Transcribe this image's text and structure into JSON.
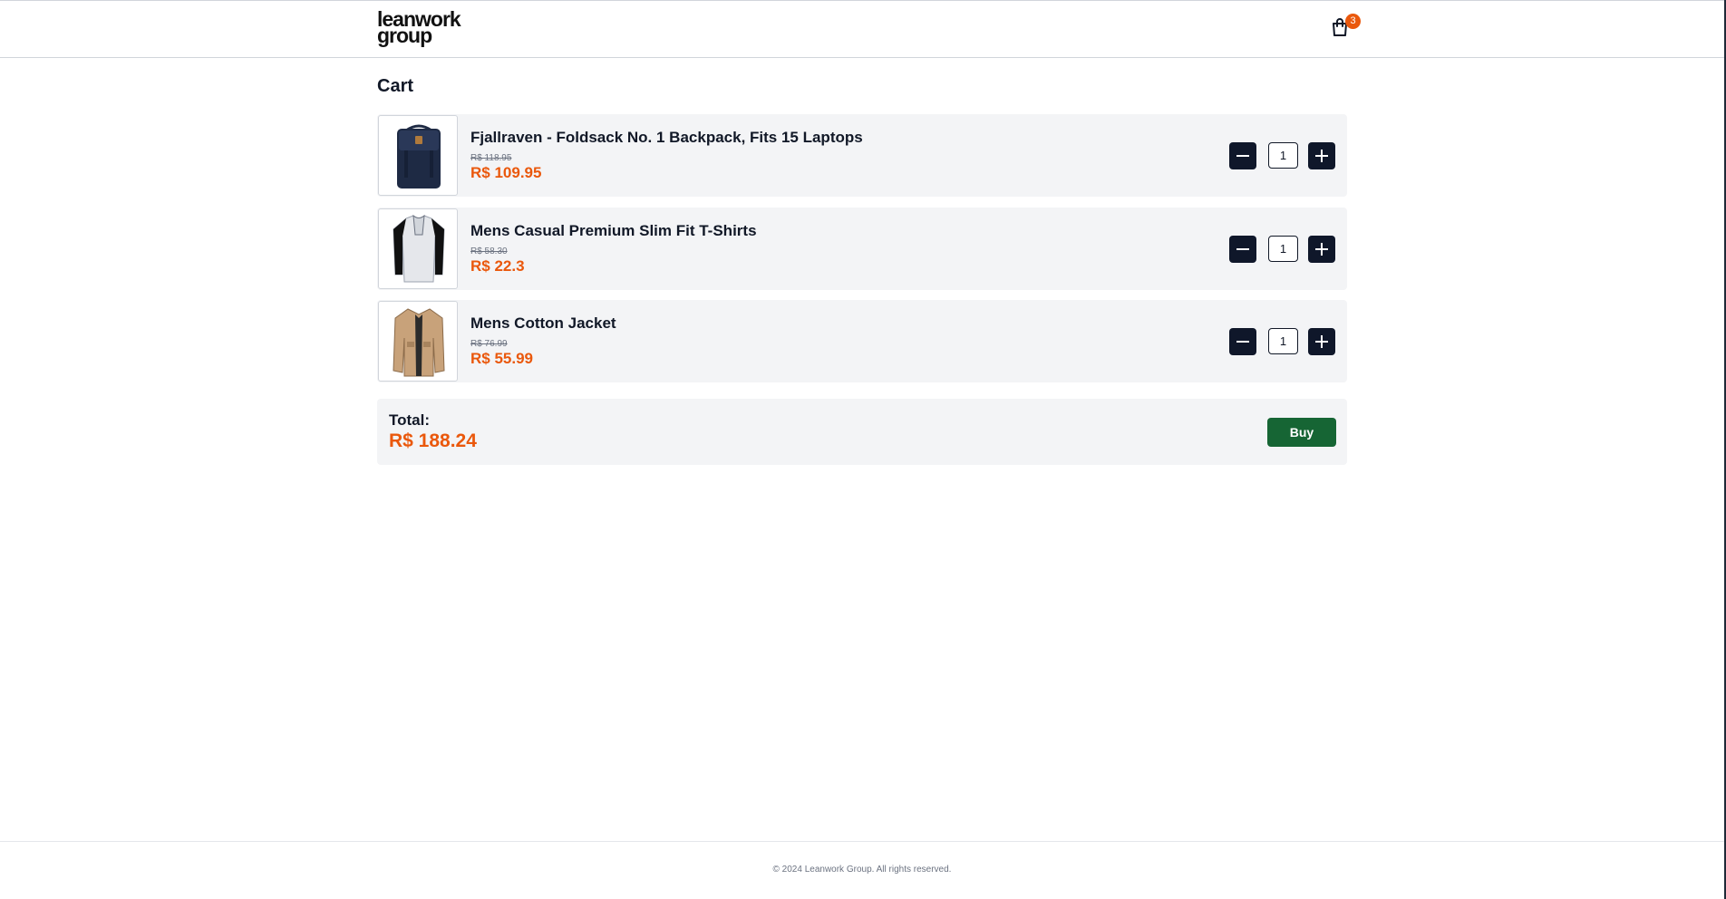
{
  "header": {
    "logo_line1": "leanwork",
    "logo_line2": "group",
    "cart_count": "3"
  },
  "main": {
    "title": "Cart",
    "items": [
      {
        "name": "Fjallraven - Foldsack No. 1 Backpack, Fits 15 Laptops",
        "old_price": "R$ 118.95",
        "price": "R$ 109.95",
        "quantity": "1",
        "image_icon": "backpack-icon"
      },
      {
        "name": "Mens Casual Premium Slim Fit T-Shirts",
        "old_price": "R$ 58.30",
        "price": "R$ 22.3",
        "quantity": "1",
        "image_icon": "tshirt-icon"
      },
      {
        "name": "Mens Cotton Jacket",
        "old_price": "R$ 76.99",
        "price": "R$ 55.99",
        "quantity": "1",
        "image_icon": "jacket-icon"
      }
    ],
    "total_label": "Total:",
    "total_value": "R$ 188.24",
    "buy_label": "Buy"
  },
  "footer": {
    "copyright": "© 2024 Leanwork Group. All rights reserved."
  },
  "colors": {
    "accent": "#ea580c",
    "buy_button": "#166534",
    "qty_button": "#0f172a",
    "item_background": "#f3f4f6"
  }
}
